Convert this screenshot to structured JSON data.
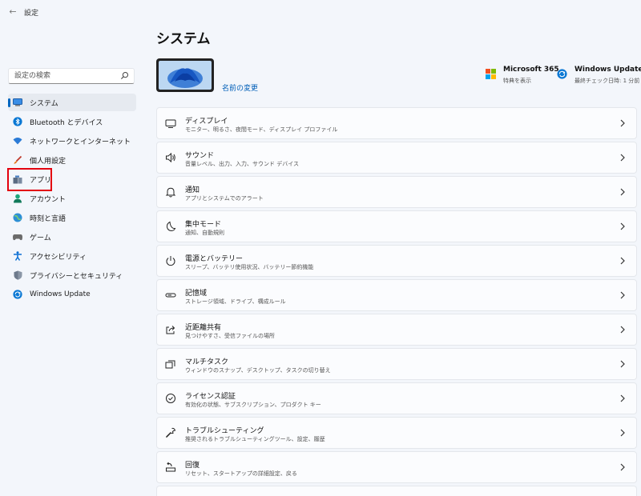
{
  "window": {
    "title": "設定",
    "back_glyph": "←"
  },
  "search": {
    "placeholder": "設定の検索"
  },
  "sidebar": {
    "items": [
      {
        "label": "システム",
        "icon": "monitor-icon",
        "selected": true
      },
      {
        "label": "Bluetooth とデバイス",
        "icon": "bluetooth-icon"
      },
      {
        "label": "ネットワークとインターネット",
        "icon": "wifi-icon"
      },
      {
        "label": "個人用設定",
        "icon": "brush-icon"
      },
      {
        "label": "アプリ",
        "icon": "apps-icon"
      },
      {
        "label": "アカウント",
        "icon": "person-icon"
      },
      {
        "label": "時刻と言語",
        "icon": "globe-clock-icon"
      },
      {
        "label": "ゲーム",
        "icon": "gamepad-icon"
      },
      {
        "label": "アクセシビリティ",
        "icon": "accessibility-icon"
      },
      {
        "label": "プライバシーとセキュリティ",
        "icon": "shield-icon"
      },
      {
        "label": "Windows Update",
        "icon": "update-icon"
      }
    ]
  },
  "header": {
    "title": "システム",
    "rename_label": "名前の変更",
    "ms365": {
      "title": "Microsoft 365",
      "subtitle": "特典を表示"
    },
    "update": {
      "title": "Windows Update",
      "subtitle": "最終チェック日時: 1 分前"
    }
  },
  "settings": [
    {
      "title": "ディスプレイ",
      "subtitle": "モニター、明るさ、夜間モード、ディスプレイ プロファイル",
      "icon": "display-icon"
    },
    {
      "title": "サウンド",
      "subtitle": "音量レベル、出力、入力、サウンド デバイス",
      "icon": "speaker-icon"
    },
    {
      "title": "通知",
      "subtitle": "アプリとシステムでのアラート",
      "icon": "bell-icon"
    },
    {
      "title": "集中モード",
      "subtitle": "通知、自動規則",
      "icon": "moon-icon"
    },
    {
      "title": "電源とバッテリー",
      "subtitle": "スリープ、バッテリ使用状況、バッテリー節約機能",
      "icon": "power-icon"
    },
    {
      "title": "記憶域",
      "subtitle": "ストレージ領域、ドライブ、構成ルール",
      "icon": "storage-icon"
    },
    {
      "title": "近距離共有",
      "subtitle": "見つけやすさ、受信ファイルの場所",
      "icon": "share-icon"
    },
    {
      "title": "マルチタスク",
      "subtitle": "ウィンドウのスナップ、デスクトップ、タスクの切り替え",
      "icon": "multitask-icon"
    },
    {
      "title": "ライセンス認証",
      "subtitle": "有効化の状態、サブスクリプション、プロダクト キー",
      "icon": "check-circle-icon"
    },
    {
      "title": "トラブルシューティング",
      "subtitle": "推奨されるトラブルシューティングツール、設定、履歴",
      "icon": "wrench-icon"
    },
    {
      "title": "回復",
      "subtitle": "リセット、スタートアップの詳細設定、戻る",
      "icon": "recovery-icon"
    }
  ],
  "colors": {
    "accent": "#0067c0",
    "link": "#005fb8",
    "highlight_box": "#e3000f",
    "background": "#f3f6fb"
  }
}
